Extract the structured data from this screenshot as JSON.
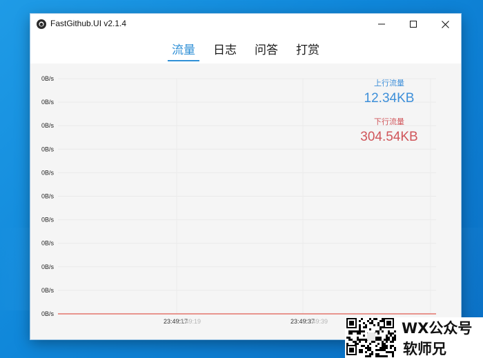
{
  "window": {
    "title": "FastGithub.UI v2.1.4"
  },
  "tabs": [
    {
      "label": "流量",
      "active": true
    },
    {
      "label": "日志",
      "active": false
    },
    {
      "label": "问答",
      "active": false
    },
    {
      "label": "打赏",
      "active": false
    }
  ],
  "stats": {
    "upload_label": "上行流量",
    "upload_value": "12.34KB",
    "download_label": "下行流量",
    "download_value": "304.54KB"
  },
  "colors": {
    "accent": "#2e8fd6",
    "upload": "#3d8fd9",
    "download": "#d0555a",
    "series_line": "#e05a4f"
  },
  "chart_data": {
    "type": "line",
    "y_tick_labels": [
      "0B/s",
      "0B/s",
      "0B/s",
      "0B/s",
      "0B/s",
      "0B/s",
      "0B/s",
      "0B/s",
      "0B/s",
      "0B/s",
      "0B/s"
    ],
    "x_tick_labels": [
      {
        "text": "23:49:17",
        "ghost": false
      },
      {
        "text": "23:49:19",
        "ghost": true
      },
      {
        "text": "23:49:37",
        "ghost": false
      },
      {
        "text": "23:49:39",
        "ghost": true
      }
    ],
    "series": [
      {
        "values": [
          0,
          0,
          0,
          0,
          0,
          0
        ]
      }
    ],
    "grid": true
  },
  "watermark": {
    "line1": "WX公众号",
    "line2": "软师兄"
  }
}
